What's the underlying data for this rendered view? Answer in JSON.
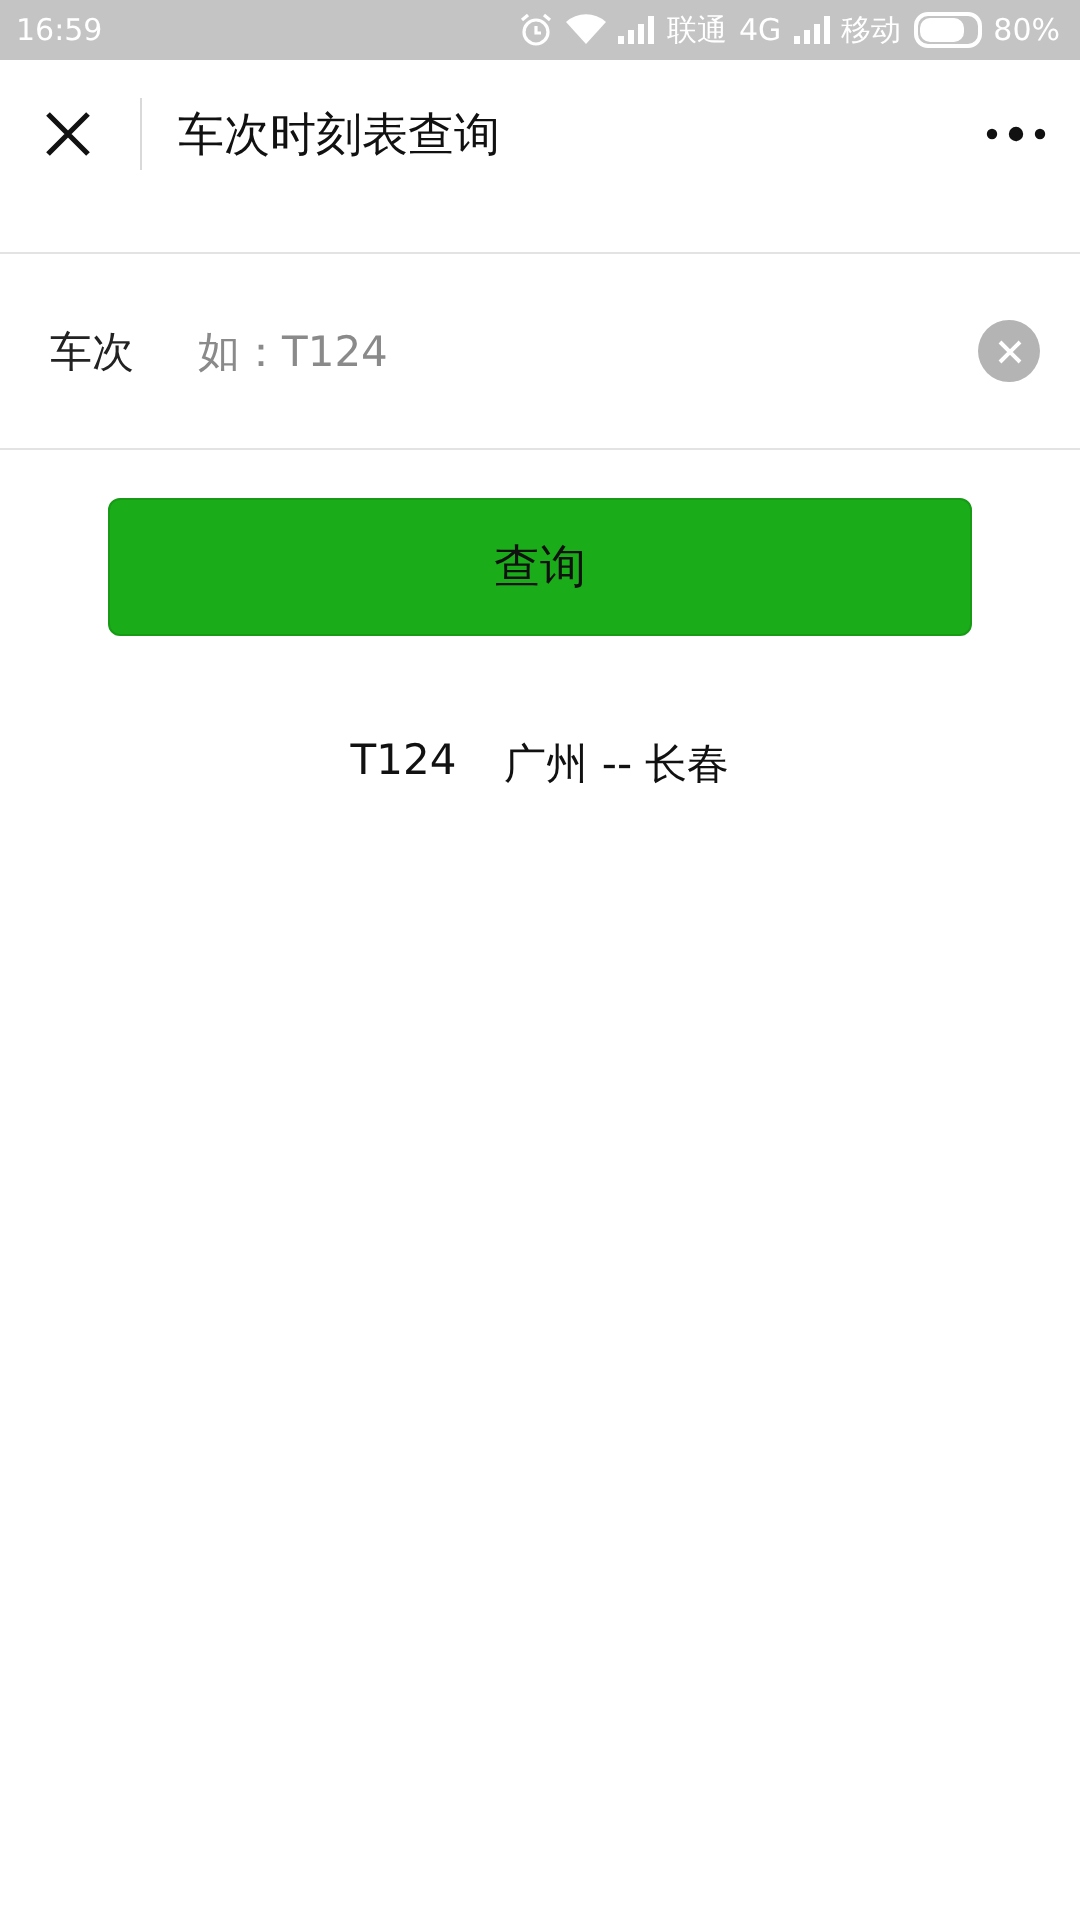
{
  "status_bar": {
    "time": "16:59",
    "carrier_1": "联通",
    "network": "4G",
    "carrier_2": "移动",
    "battery": "80%"
  },
  "header": {
    "title": "车次时刻表查询"
  },
  "form": {
    "label": "车次",
    "placeholder": "如：T124"
  },
  "button": "查询",
  "result": {
    "train": "T124",
    "route": "广州 -- 长春"
  }
}
